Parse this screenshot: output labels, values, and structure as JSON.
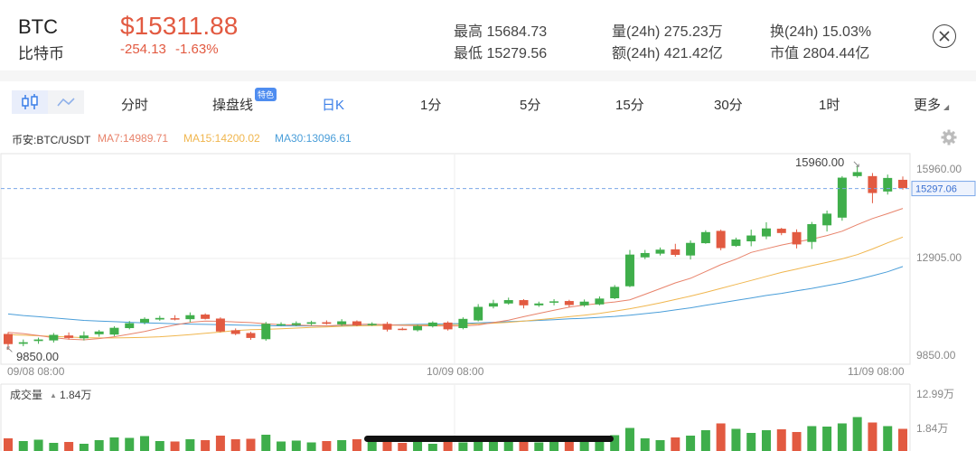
{
  "header": {
    "symbol": "BTC",
    "name_cn": "比特币",
    "price": "$15311.88",
    "change": "-254.13",
    "change_pct": "-1.63%",
    "stats": {
      "high": "最高 15684.73",
      "low": "最低 15279.56",
      "vol24": "量(24h) 275.23万",
      "amount24": "额(24h) 421.42亿",
      "turnover24": "换(24h) 15.03%",
      "market_cap": "市值 2804.44亿"
    }
  },
  "tabs": {
    "items": [
      "分时",
      "操盘线",
      "日K",
      "1分",
      "5分",
      "15分",
      "30分",
      "1时",
      "更多"
    ],
    "badge": "特色",
    "active": "日K"
  },
  "legend": {
    "pair": "币安:BTC/USDT",
    "ma7": "MA7:14989.71",
    "ma15": "MA15:14200.02",
    "ma30": "MA30:13096.61"
  },
  "colors": {
    "up": "#3fae4b",
    "down": "#e25a41",
    "ma7": "#e8836b",
    "ma15": "#f0b64e",
    "ma30": "#4a9ed9",
    "accent": "#3a7ee8"
  },
  "chart_data": {
    "type": "candlestick",
    "price_axis_labels": [
      "15960.00",
      "12905.00",
      "9850.00"
    ],
    "price_range": [
      9850,
      15960
    ],
    "current_price_label": "15297.06",
    "current_price": 15297.06,
    "max_label": "15960.00",
    "min_label": "9850.00",
    "date_labels": [
      "09/08 08:00",
      "10/09 08:00",
      "11/09 08:00"
    ],
    "candles": [
      {
        "o": 10570,
        "c": 10240,
        "h": 10630,
        "l": 10060
      },
      {
        "o": 10250,
        "c": 10300,
        "h": 10390,
        "l": 10170
      },
      {
        "o": 10340,
        "c": 10390,
        "h": 10450,
        "l": 10250
      },
      {
        "o": 10360,
        "c": 10540,
        "h": 10600,
        "l": 10290
      },
      {
        "o": 10520,
        "c": 10440,
        "h": 10620,
        "l": 10390
      },
      {
        "o": 10430,
        "c": 10520,
        "h": 10650,
        "l": 10360
      },
      {
        "o": 10560,
        "c": 10650,
        "h": 10700,
        "l": 10480
      },
      {
        "o": 10550,
        "c": 10770,
        "h": 10820,
        "l": 10500
      },
      {
        "o": 10760,
        "c": 10920,
        "h": 10990,
        "l": 10720
      },
      {
        "o": 10940,
        "c": 11060,
        "h": 11110,
        "l": 10880
      },
      {
        "o": 11040,
        "c": 11090,
        "h": 11160,
        "l": 11000
      },
      {
        "o": 11080,
        "c": 11060,
        "h": 11180,
        "l": 11010
      },
      {
        "o": 11050,
        "c": 11180,
        "h": 11270,
        "l": 10950
      },
      {
        "o": 11200,
        "c": 11060,
        "h": 11240,
        "l": 11040
      },
      {
        "o": 11070,
        "c": 10650,
        "h": 11110,
        "l": 10620
      },
      {
        "o": 10690,
        "c": 10570,
        "h": 10750,
        "l": 10530
      },
      {
        "o": 10600,
        "c": 10440,
        "h": 10640,
        "l": 10380
      },
      {
        "o": 10400,
        "c": 10900,
        "h": 10960,
        "l": 10350
      },
      {
        "o": 10880,
        "c": 10890,
        "h": 10950,
        "l": 10830
      },
      {
        "o": 10860,
        "c": 10920,
        "h": 10980,
        "l": 10820
      },
      {
        "o": 10900,
        "c": 10950,
        "h": 11000,
        "l": 10850
      },
      {
        "o": 10950,
        "c": 10900,
        "h": 11010,
        "l": 10870
      },
      {
        "o": 10880,
        "c": 10980,
        "h": 11050,
        "l": 10830
      },
      {
        "o": 10980,
        "c": 10850,
        "h": 11010,
        "l": 10820
      },
      {
        "o": 10870,
        "c": 10900,
        "h": 10950,
        "l": 10830
      },
      {
        "o": 10900,
        "c": 10710,
        "h": 10960,
        "l": 10650
      },
      {
        "o": 10740,
        "c": 10720,
        "h": 10780,
        "l": 10690
      },
      {
        "o": 10690,
        "c": 10830,
        "h": 10870,
        "l": 10650
      },
      {
        "o": 10820,
        "c": 10940,
        "h": 10980,
        "l": 10780
      },
      {
        "o": 10940,
        "c": 10720,
        "h": 10980,
        "l": 10680
      },
      {
        "o": 10760,
        "c": 11060,
        "h": 11110,
        "l": 10720
      },
      {
        "o": 11010,
        "c": 11450,
        "h": 11540,
        "l": 10980
      },
      {
        "o": 11460,
        "c": 11570,
        "h": 11680,
        "l": 11400
      },
      {
        "o": 11560,
        "c": 11670,
        "h": 11750,
        "l": 11520
      },
      {
        "o": 11670,
        "c": 11500,
        "h": 11700,
        "l": 11400
      },
      {
        "o": 11500,
        "c": 11560,
        "h": 11620,
        "l": 11450
      },
      {
        "o": 11590,
        "c": 11630,
        "h": 11700,
        "l": 11500
      },
      {
        "o": 11640,
        "c": 11510,
        "h": 11680,
        "l": 11440
      },
      {
        "o": 11500,
        "c": 11620,
        "h": 11690,
        "l": 11450
      },
      {
        "o": 11530,
        "c": 11720,
        "h": 11790,
        "l": 11500
      },
      {
        "o": 11730,
        "c": 12100,
        "h": 12160,
        "l": 11700
      },
      {
        "o": 12120,
        "c": 13150,
        "h": 13300,
        "l": 12090
      },
      {
        "o": 13060,
        "c": 13200,
        "h": 13300,
        "l": 13000
      },
      {
        "o": 13180,
        "c": 13310,
        "h": 13380,
        "l": 13120
      },
      {
        "o": 13320,
        "c": 13140,
        "h": 13500,
        "l": 13080
      },
      {
        "o": 13120,
        "c": 13530,
        "h": 13610,
        "l": 12990
      },
      {
        "o": 13520,
        "c": 13880,
        "h": 13940,
        "l": 13500
      },
      {
        "o": 13920,
        "c": 13360,
        "h": 13960,
        "l": 13290
      },
      {
        "o": 13430,
        "c": 13640,
        "h": 13700,
        "l": 13400
      },
      {
        "o": 13580,
        "c": 13770,
        "h": 13960,
        "l": 13420
      },
      {
        "o": 13740,
        "c": 14000,
        "h": 14200,
        "l": 13650
      },
      {
        "o": 13990,
        "c": 13850,
        "h": 14020,
        "l": 13780
      },
      {
        "o": 13880,
        "c": 13480,
        "h": 13970,
        "l": 13350
      },
      {
        "o": 13560,
        "c": 14140,
        "h": 14210,
        "l": 13330
      },
      {
        "o": 14100,
        "c": 14480,
        "h": 14580,
        "l": 13900
      },
      {
        "o": 14350,
        "c": 15650,
        "h": 15700,
        "l": 14250
      },
      {
        "o": 15700,
        "c": 15830,
        "h": 16040,
        "l": 15650
      },
      {
        "o": 15700,
        "c": 15150,
        "h": 15800,
        "l": 14820
      },
      {
        "o": 15200,
        "c": 15640,
        "h": 15750,
        "l": 15100
      },
      {
        "o": 15580,
        "c": 15310,
        "h": 15690,
        "l": 15260
      }
    ],
    "ma7": [
      10620,
      10580,
      10520,
      10450,
      10400,
      10380,
      10420,
      10480,
      10560,
      10650,
      10760,
      10860,
      10950,
      10990,
      10980,
      10960,
      10940,
      10900,
      10870,
      10860,
      10840,
      10830,
      10860,
      10880,
      10890,
      10870,
      10850,
      10840,
      10830,
      10830,
      10830,
      10860,
      10940,
      11020,
      11130,
      11240,
      11340,
      11440,
      11510,
      11560,
      11610,
      11680,
      11860,
      12040,
      12230,
      12380,
      12600,
      12820,
      13000,
      13220,
      13340,
      13460,
      13560,
      13650,
      13770,
      13910,
      14120,
      14320,
      14480,
      14650
    ],
    "ma15": [
      10550,
      10530,
      10510,
      10490,
      10470,
      10450,
      10440,
      10440,
      10450,
      10460,
      10480,
      10510,
      10550,
      10590,
      10630,
      10680,
      10710,
      10720,
      10740,
      10760,
      10780,
      10800,
      10820,
      10830,
      10840,
      10850,
      10860,
      10860,
      10860,
      10870,
      10880,
      10900,
      10920,
      10950,
      10990,
      11030,
      11080,
      11130,
      11180,
      11240,
      11310,
      11390,
      11480,
      11580,
      11690,
      11800,
      11920,
      12050,
      12180,
      12310,
      12440,
      12570,
      12680,
      12790,
      12900,
      13010,
      13150,
      13330,
      13530,
      13720
    ],
    "ma30": [
      11220,
      11170,
      11130,
      11090,
      11050,
      11010,
      10990,
      10970,
      10950,
      10930,
      10920,
      10900,
      10890,
      10880,
      10870,
      10860,
      10850,
      10840,
      10830,
      10830,
      10830,
      10830,
      10840,
      10840,
      10850,
      10860,
      10870,
      10880,
      10890,
      10900,
      10910,
      10930,
      10950,
      10970,
      10990,
      11010,
      11030,
      11060,
      11080,
      11110,
      11140,
      11180,
      11230,
      11280,
      11350,
      11420,
      11500,
      11580,
      11660,
      11740,
      11820,
      11890,
      11970,
      12050,
      12140,
      12230,
      12340,
      12460,
      12590,
      12760
    ],
    "volume_label": "成交量",
    "volume_value": "1.84万",
    "volume_axis_labels": [
      "12.99万",
      "1.84万"
    ],
    "volumes": [
      2.8,
      2.2,
      2.5,
      1.8,
      2.0,
      1.6,
      2.4,
      3.0,
      2.9,
      3.3,
      2.2,
      2.1,
      2.6,
      2.4,
      3.4,
      2.6,
      2.7,
      3.6,
      2.1,
      2.3,
      1.9,
      2.2,
      2.4,
      2.6,
      2.1,
      2.2,
      1.8,
      2.0,
      1.6,
      2.0,
      1.9,
      2.6,
      3.1,
      2.4,
      2.3,
      1.9,
      2.1,
      2.0,
      2.0,
      2.7,
      3.5,
      5.1,
      2.8,
      2.4,
      3.0,
      3.4,
      4.6,
      6.1,
      4.9,
      4.0,
      4.6,
      4.8,
      4.2,
      5.5,
      5.4,
      6.1,
      7.5,
      6.3,
      5.5,
      4.9
    ],
    "volume_max": 12.99
  }
}
